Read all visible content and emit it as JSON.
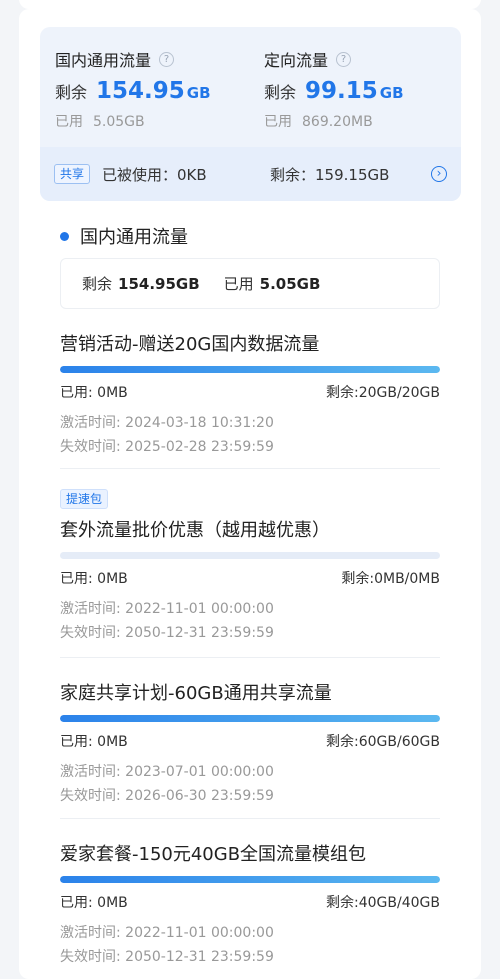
{
  "summary": {
    "domestic": {
      "title": "国内通用流量",
      "remain_label": "剩余",
      "remain_value": "154.95",
      "remain_unit": "GB",
      "used_label": "已用",
      "used_value": "5.05GB"
    },
    "directed": {
      "title": "定向流量",
      "remain_label": "剩余",
      "remain_value": "99.15",
      "remain_unit": "GB",
      "used_label": "已用",
      "used_value": "869.20MB"
    },
    "share": {
      "tag": "共享",
      "used_text": "已被使用：0KB",
      "remain_text": "剩余：159.15GB"
    }
  },
  "section": {
    "title": "国内通用流量",
    "stats": {
      "remain_label": "剩余",
      "remain_value": "154.95GB",
      "used_label": "已用",
      "used_value": "5.05GB"
    }
  },
  "plans": [
    {
      "tag": "",
      "title": "营销活动-赠送20G国内数据流量",
      "used": "已用: 0MB",
      "remain": "剩余:20GB/20GB",
      "progress_remaining": 1.0,
      "activated": "激活时间: 2024-03-18 10:31:20",
      "expires": "失效时间: 2025-02-28 23:59:59"
    },
    {
      "tag": "提速包",
      "title": "套外流量批价优惠（越用越优惠）",
      "used": "已用: 0MB",
      "remain": "剩余:0MB/0MB",
      "progress_remaining": 0.0,
      "activated": "激活时间: 2022-11-01 00:00:00",
      "expires": "失效时间: 2050-12-31 23:59:59"
    },
    {
      "tag": "",
      "title": "家庭共享计划-60GB通用共享流量",
      "used": "已用: 0MB",
      "remain": "剩余:60GB/60GB",
      "progress_remaining": 1.0,
      "activated": "激活时间: 2023-07-01 00:00:00",
      "expires": "失效时间: 2026-06-30 23:59:59"
    },
    {
      "tag": "",
      "title": "爱家套餐-150元40GB全国流量模组包",
      "used": "已用: 0MB",
      "remain": "剩余:40GB/40GB",
      "progress_remaining": 1.0,
      "activated": "激活时间: 2022-11-01 00:00:00",
      "expires": "失效时间: 2050-12-31 23:59:59"
    }
  ],
  "colors": {
    "accent": "#2176e8",
    "muted": "#999999"
  },
  "icons": {
    "help": "question-circle-icon",
    "arrow": "chevron-right-circle-icon"
  }
}
